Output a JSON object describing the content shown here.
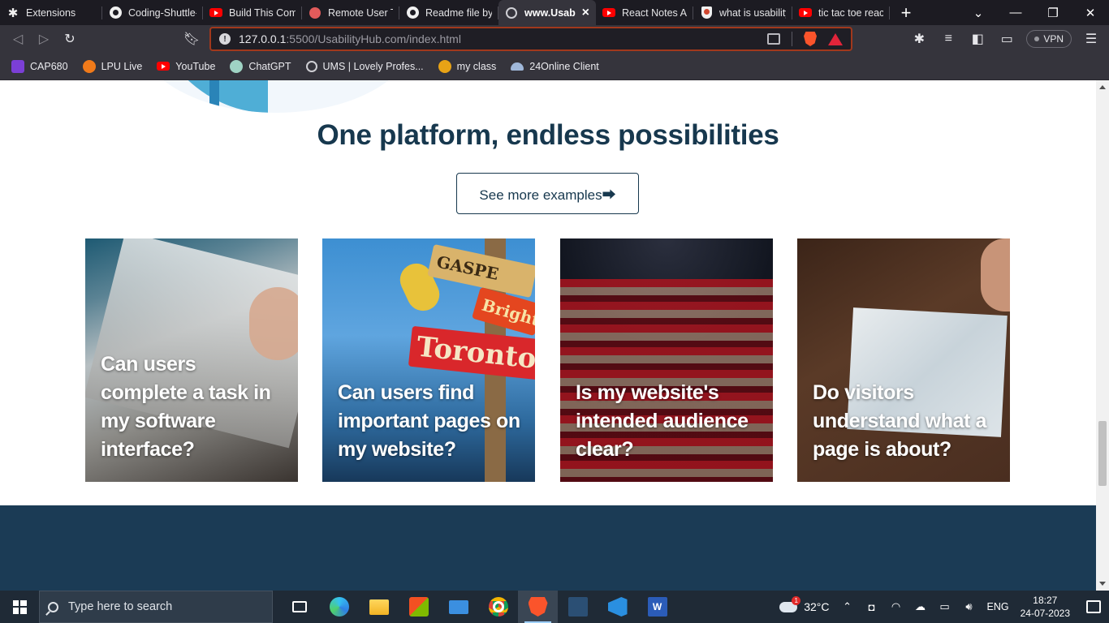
{
  "browser": {
    "tabs": [
      {
        "title": "Extensions",
        "icon": "puzzle-icon",
        "active": false
      },
      {
        "title": "Coding-Shuttle-",
        "icon": "github-icon",
        "active": false
      },
      {
        "title": "Build This Comp",
        "icon": "youtube-icon",
        "active": false
      },
      {
        "title": "Remote User Te",
        "icon": "red-circle-icon",
        "active": false
      },
      {
        "title": "Readme file by",
        "icon": "github-icon",
        "active": false
      },
      {
        "title": "www.Usabil",
        "icon": "globe-icon",
        "active": true
      },
      {
        "title": "React Notes Ap",
        "icon": "youtube-icon",
        "active": false
      },
      {
        "title": "what is usability",
        "icon": "shield-icon",
        "active": false
      },
      {
        "title": "tic tac toe react",
        "icon": "youtube-icon",
        "active": false
      }
    ],
    "url_host": "127.0.0.1",
    "url_rest": ":5500/UsabilityHub.com/index.html",
    "vpn_label": "VPN",
    "bookmarks": [
      {
        "label": "CAP680",
        "icon": "cap-icon"
      },
      {
        "label": "LPU Live",
        "icon": "lpu-icon"
      },
      {
        "label": "YouTube",
        "icon": "youtube-icon"
      },
      {
        "label": "ChatGPT",
        "icon": "chatgpt-icon"
      },
      {
        "label": "UMS | Lovely Profes...",
        "icon": "globe-icon"
      },
      {
        "label": "my class",
        "icon": "class-icon"
      },
      {
        "label": "24Online Client",
        "icon": "online-icon"
      }
    ]
  },
  "page": {
    "heading": "One platform, endless possibilities",
    "cta_label": "See more examples⮕",
    "cards": [
      {
        "title": "Can users complete a task in my software interface?"
      },
      {
        "title": "Can users find important pages on my website?"
      },
      {
        "title": "Is my website's intended audience clear?"
      },
      {
        "title": "Do visitors understand what a page is about?"
      }
    ],
    "card2_signs": [
      "GASPE",
      "Bright",
      "Toronto"
    ]
  },
  "taskbar": {
    "search_placeholder": "Type here to search",
    "weather_temp": "32°C",
    "weather_badge": "1",
    "language": "ENG",
    "time": "18:27",
    "date": "24-07-2023"
  },
  "colors": {
    "heading": "#17384e",
    "footer_band": "#1b3b55",
    "urlbar_border": "#a1381c",
    "tab_strip": "#1c1b22",
    "toolbar": "#35343c"
  }
}
